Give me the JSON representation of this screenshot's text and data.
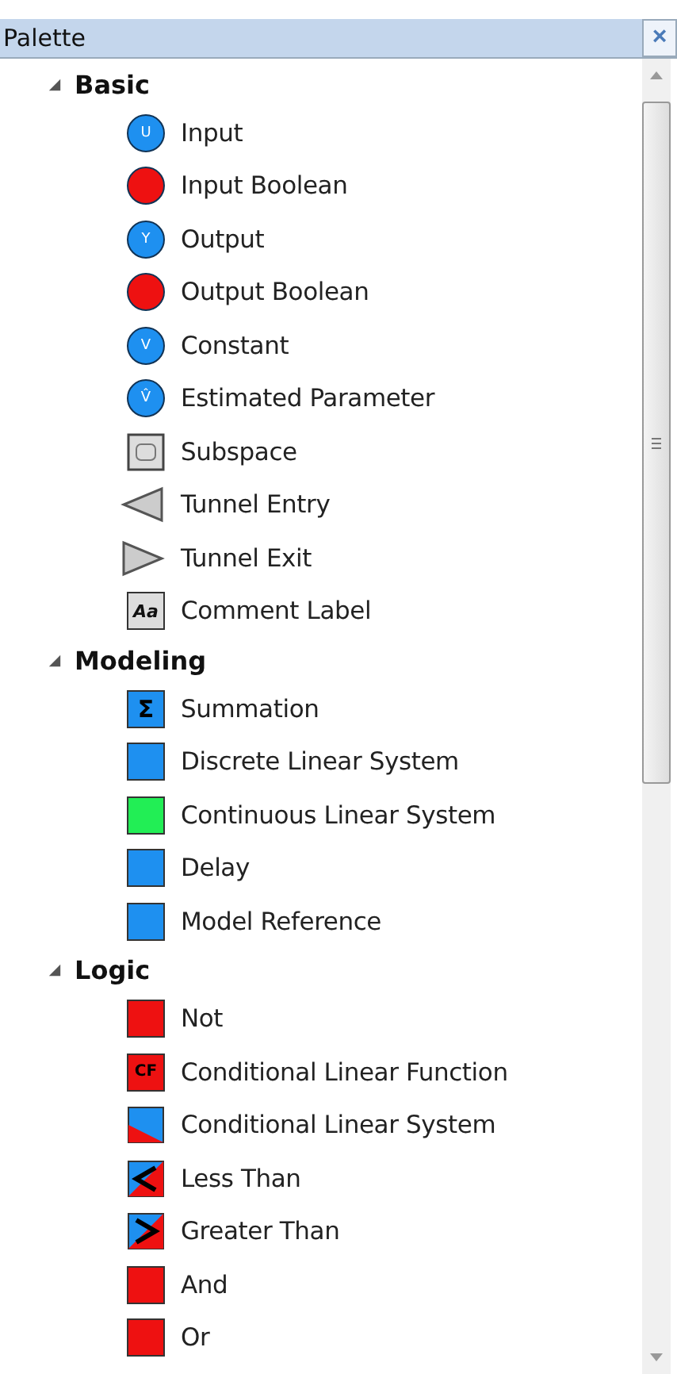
{
  "panel": {
    "title": "Palette",
    "close": "×"
  },
  "groups": [
    {
      "label": "Basic",
      "expanded": true,
      "items": [
        {
          "label": "Input",
          "kind": "circle",
          "color": "#1e90f0",
          "glyph": "U"
        },
        {
          "label": "Input Boolean",
          "kind": "circle",
          "color": "#ee1111"
        },
        {
          "label": "Output",
          "kind": "circle",
          "color": "#1e90f0",
          "glyph": "Y"
        },
        {
          "label": "Output Boolean",
          "kind": "circle",
          "color": "#ee1111"
        },
        {
          "label": "Constant",
          "kind": "circle",
          "color": "#1e90f0",
          "glyph": "V"
        },
        {
          "label": "Estimated Parameter",
          "kind": "circle",
          "color": "#1e90f0",
          "glyph": "V̂"
        },
        {
          "label": "Subspace",
          "kind": "frame"
        },
        {
          "label": "Tunnel Entry",
          "kind": "arrow-left"
        },
        {
          "label": "Tunnel Exit",
          "kind": "arrow-right"
        },
        {
          "label": "Comment Label",
          "kind": "label",
          "glyph": "Aa"
        }
      ]
    },
    {
      "label": "Modeling",
      "expanded": true,
      "items": [
        {
          "label": "Summation",
          "kind": "block",
          "color": "#1e90f0",
          "glyph": "Σ"
        },
        {
          "label": "Discrete Linear System",
          "kind": "block",
          "color": "#1e90f0"
        },
        {
          "label": "Continuous Linear System",
          "kind": "block",
          "color": "#22ee55"
        },
        {
          "label": "Delay",
          "kind": "block",
          "color": "#1e90f0"
        },
        {
          "label": "Model Reference",
          "kind": "block",
          "color": "#1e90f0"
        }
      ]
    },
    {
      "label": "Logic",
      "expanded": true,
      "items": [
        {
          "label": "Not",
          "kind": "block",
          "color": "#ee1111"
        },
        {
          "label": "Conditional Linear Function",
          "kind": "split-corner",
          "color": "#ee1111",
          "glyph": "CF"
        },
        {
          "label": "Conditional Linear System",
          "kind": "split-diagonal",
          "color": "#ee1111"
        },
        {
          "label": "Less Than",
          "kind": "compare-less",
          "color": "#ee1111"
        },
        {
          "label": "Greater Than",
          "kind": "compare-greater",
          "color": "#ee1111"
        },
        {
          "label": "And",
          "kind": "block",
          "color": "#ee1111"
        },
        {
          "label": "Or",
          "kind": "block",
          "color": "#ee1111"
        }
      ]
    }
  ]
}
